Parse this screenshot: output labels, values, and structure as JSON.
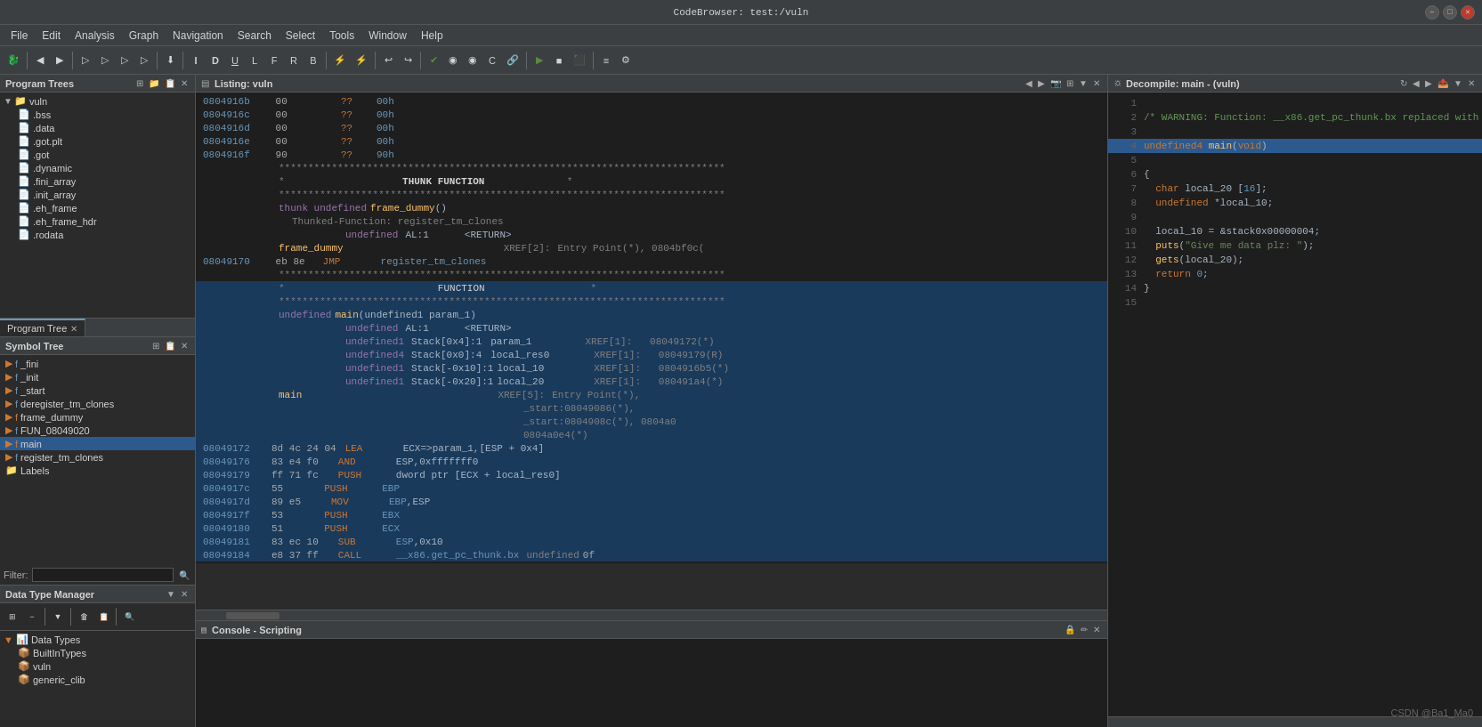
{
  "titlebar": {
    "title": "CodeBrowser: test:/vuln",
    "min": "−",
    "max": "□",
    "close": "✕"
  },
  "menubar": {
    "items": [
      "File",
      "Edit",
      "Analysis",
      "Graph",
      "Navigation",
      "Search",
      "Select",
      "Tools",
      "Window",
      "Help"
    ]
  },
  "left_panel": {
    "program_trees_title": "Program Trees",
    "program_trees_tab": "Program Tree",
    "symbol_tree_title": "Symbol Tree",
    "filter_label": "Filter:",
    "filter_placeholder": "",
    "program_tree_root": "vuln",
    "sections": [
      ".bss",
      ".data",
      ".got.plt",
      ".got",
      ".dynamic",
      ".fini_array",
      ".init_array",
      ".eh_frame",
      ".eh_frame_hdr",
      ".rodata"
    ],
    "symbol_tree_items": [
      "_fini",
      "_init",
      "_start",
      "deregister_tm_clones",
      "frame_dummy",
      "FUN_08049020",
      "main",
      "register_tm_clones"
    ],
    "labels_item": "Labels"
  },
  "listing": {
    "title": "Listing:  vuln"
  },
  "decompile": {
    "title": "Decompile: main - (vuln)"
  },
  "console": {
    "title": "Console - Scripting"
  },
  "data_type_manager": {
    "title": "Data Type Manager",
    "items": [
      "Data Types",
      "BuiltInTypes",
      "vuln",
      "generic_clib"
    ]
  },
  "asm_lines": [
    {
      "addr": "0804916b",
      "bytes": "00",
      "mnem": "??",
      "ops": "00h",
      "comment": ""
    },
    {
      "addr": "0804916c",
      "bytes": "00",
      "mnem": "??",
      "ops": "00h",
      "comment": ""
    },
    {
      "addr": "0804916d",
      "bytes": "00",
      "mnem": "??",
      "ops": "00h",
      "comment": ""
    },
    {
      "addr": "0804916e",
      "bytes": "00",
      "mnem": "??",
      "ops": "00h",
      "comment": ""
    },
    {
      "addr": "0804916f",
      "bytes": "90",
      "mnem": "??",
      "ops": "90h",
      "comment": ""
    }
  ],
  "watermark": "CSDN @Ba1_Ma0"
}
